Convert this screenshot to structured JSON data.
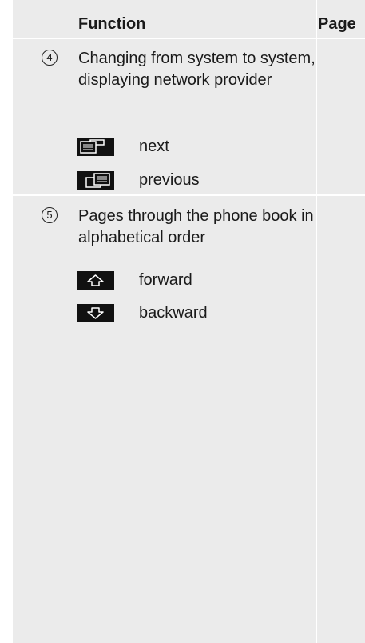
{
  "header": {
    "function": "Function",
    "page": "Page"
  },
  "rows": [
    {
      "number": "4",
      "description": "Changing from system to system, displaying network provider",
      "items": [
        {
          "icon": "next-screen-icon",
          "label": "next"
        },
        {
          "icon": "previous-screen-icon",
          "label": "previous"
        }
      ]
    },
    {
      "number": "5",
      "description": "Pages through the phone book in alphabetical order",
      "items": [
        {
          "icon": "arrow-up-icon",
          "label": "forward"
        },
        {
          "icon": "arrow-down-icon",
          "label": "backward"
        }
      ]
    }
  ]
}
